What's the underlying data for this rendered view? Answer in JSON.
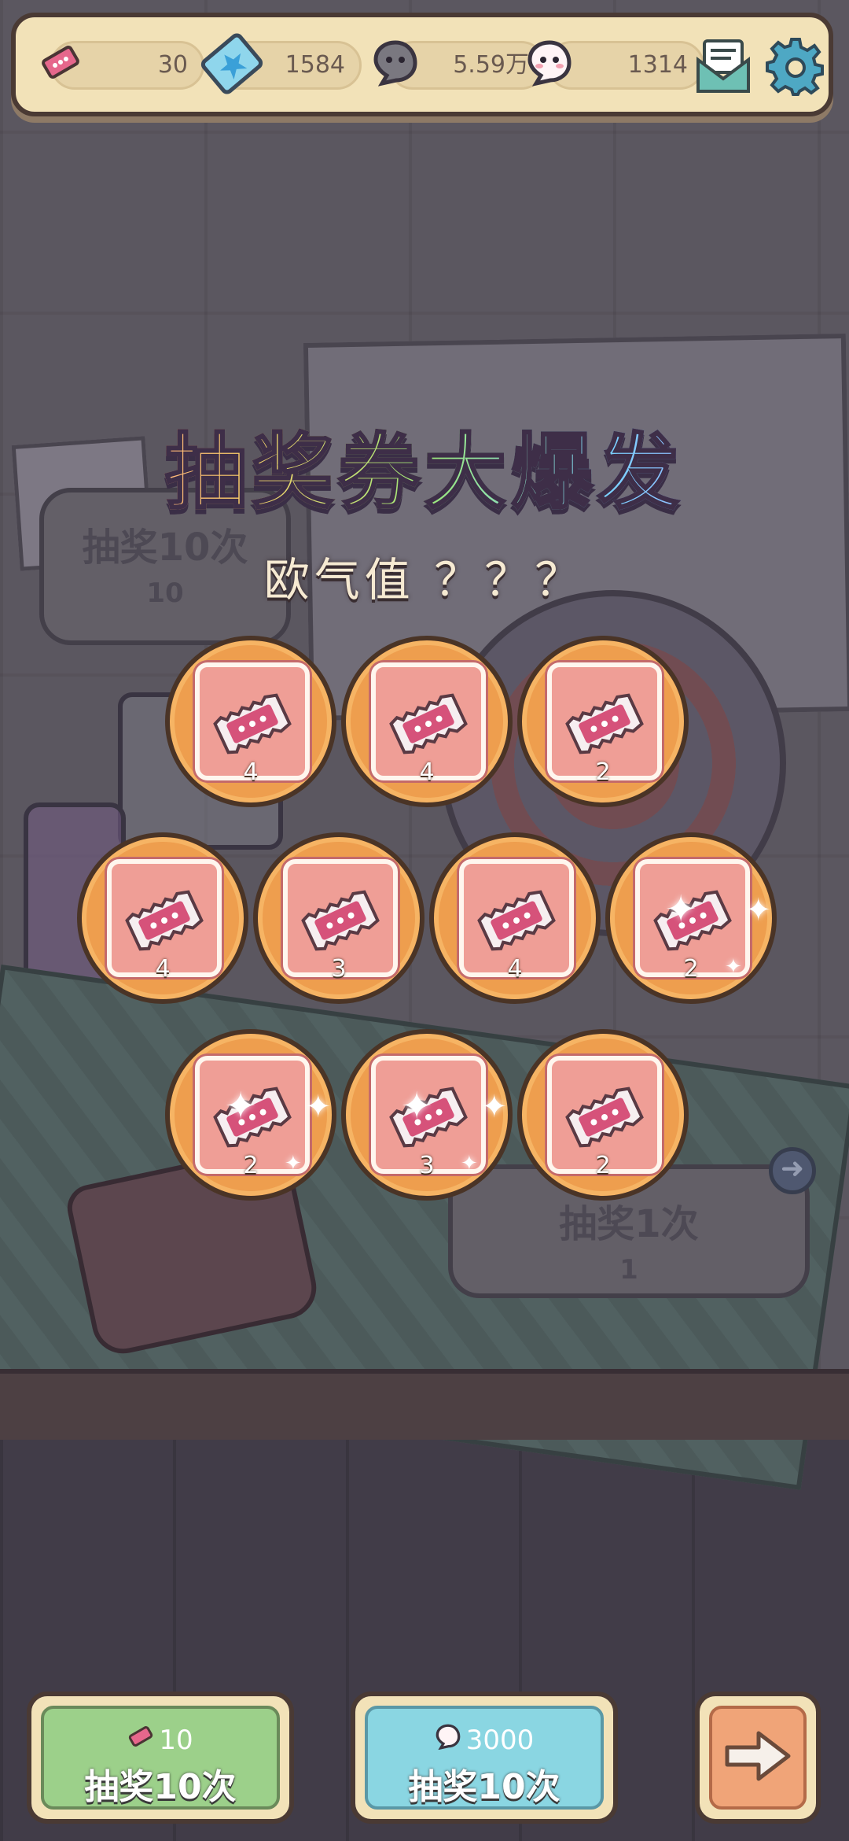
{
  "resources": {
    "tickets": "30",
    "stars": "1584",
    "dark_souls": "5.59万",
    "light_souls": "1314"
  },
  "icons": {
    "ticket": "ticket-icon",
    "star_shard": "star-shard-icon",
    "dark_soul": "dark-soul-icon",
    "light_soul": "light-soul-icon",
    "mail": "mail-icon",
    "settings": "gear-icon",
    "next": "arrow-right-icon"
  },
  "popup": {
    "title": "抽奖券大爆发",
    "subtitle": "欧气值 ？？？"
  },
  "rewards": [
    {
      "count": "4",
      "sparkle": false
    },
    {
      "count": "4",
      "sparkle": false
    },
    {
      "count": "2",
      "sparkle": false
    },
    {
      "count": "4",
      "sparkle": false
    },
    {
      "count": "3",
      "sparkle": false
    },
    {
      "count": "4",
      "sparkle": false
    },
    {
      "count": "2",
      "sparkle": true
    },
    {
      "count": "2",
      "sparkle": true
    },
    {
      "count": "3",
      "sparkle": true
    },
    {
      "count": "2",
      "sparkle": false
    }
  ],
  "background": {
    "left_bubble_title": "抽奖10次",
    "left_bubble_cost": "10",
    "right_bubble_title": "抽奖1次",
    "right_bubble_cost": "1"
  },
  "buttons": {
    "ticket_draw": {
      "cost": "10",
      "label": "抽奖10次"
    },
    "soul_draw": {
      "cost": "3000",
      "label": "抽奖10次"
    }
  },
  "colors": {
    "reward_ring": "#ee9e4e",
    "card": "#ef9e96",
    "ticket_pink": "#d6527a",
    "green_button": "#9cd08a",
    "blue_button": "#8ad6e2",
    "next_button": "#f0a478"
  }
}
